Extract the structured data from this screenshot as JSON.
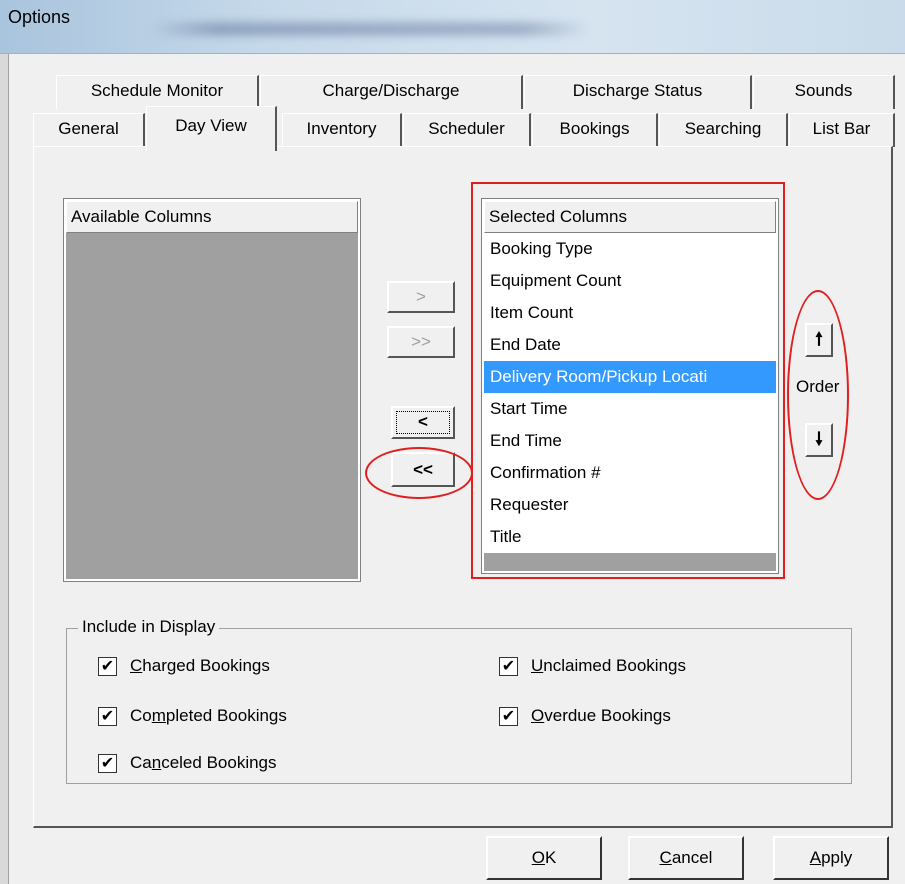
{
  "window": {
    "title": "Options"
  },
  "tabs": {
    "row1": [
      {
        "label": "Schedule Monitor"
      },
      {
        "label": "Charge/Discharge"
      },
      {
        "label": "Discharge Status"
      },
      {
        "label": "Sounds"
      }
    ],
    "row2": [
      {
        "label": "General"
      },
      {
        "label": "Day View",
        "active": true
      },
      {
        "label": "Inventory"
      },
      {
        "label": "Scheduler"
      },
      {
        "label": "Bookings"
      },
      {
        "label": "Searching"
      },
      {
        "label": "List Bar"
      }
    ]
  },
  "available": {
    "header": "Available Columns",
    "items": []
  },
  "selected": {
    "header": "Selected Columns",
    "items": [
      "Booking Type",
      "Equipment Count",
      "Item Count",
      "End Date",
      "Delivery Room/Pickup Locati",
      "Start Time",
      "End Time",
      "Confirmation #",
      "Requester",
      "Title"
    ],
    "selected_item": "Delivery Room/Pickup Locati"
  },
  "transfer": {
    "add": ">",
    "add_all": ">>",
    "remove": "<",
    "remove_all": "<<"
  },
  "order": {
    "label": "Order",
    "up": "🠕",
    "down": "🠗"
  },
  "include": {
    "label": "Include in Display",
    "options": [
      {
        "mnemonic": "C",
        "rest": "harged Bookings",
        "checked": true
      },
      {
        "prefix": "Co",
        "mnemonic": "m",
        "rest": "pleted Bookings",
        "checked": true
      },
      {
        "prefix": "Ca",
        "mnemonic": "n",
        "rest": "celed Bookings",
        "checked": true
      },
      {
        "mnemonic": "U",
        "rest": "nclaimed Bookings",
        "checked": true
      },
      {
        "mnemonic": "O",
        "rest": "verdue Bookings",
        "checked": true
      }
    ]
  },
  "buttons": {
    "ok": {
      "mnemonic": "O",
      "rest": "K"
    },
    "cancel": {
      "mnemonic": "C",
      "rest": "ancel"
    },
    "apply": {
      "mnemonic": "A",
      "rest": "pply"
    }
  },
  "colors": {
    "annotation": "#e02020",
    "selection": "#3399ff"
  },
  "check_glyph": "✔"
}
